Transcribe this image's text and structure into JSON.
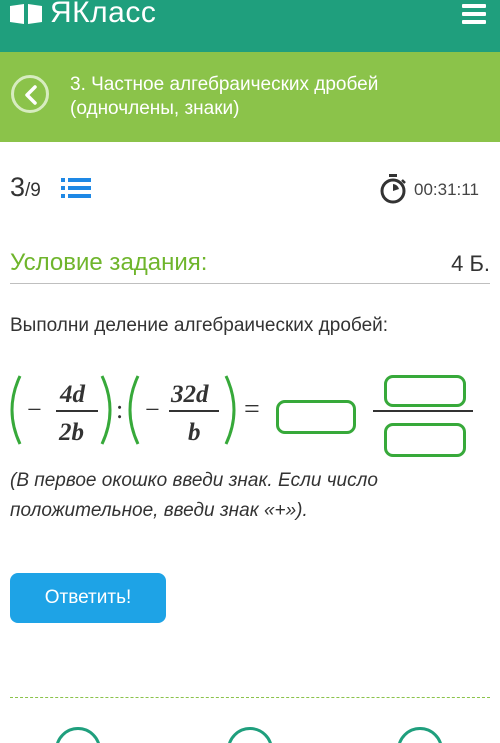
{
  "header": {
    "logo_text": "ЯКласс",
    "logo_icon": "book-icon",
    "menu_icon": "hamburger-icon"
  },
  "lesson": {
    "title": "3. Частное алгебраических дробей (одночлены, знаки)",
    "back_icon": "chevron-left-icon"
  },
  "progress": {
    "current": "3",
    "total": "/9",
    "list_icon": "list-icon"
  },
  "timer": {
    "icon": "stopwatch-icon",
    "value": "00:31:11"
  },
  "condition": {
    "title": "Условие задания:",
    "points": "4 Б."
  },
  "task": {
    "text": "Выполни деление алгебраических дробей:",
    "hint": "(В первое окошко введи знак. Если число положительное, введи знак «+»)."
  },
  "formula": {
    "frac1_num": "4d",
    "frac1_den": "2b",
    "frac2_num": "32d",
    "frac2_den": "b",
    "minus": "−",
    "div": ":",
    "eq": "="
  },
  "answer_button": "Ответить!",
  "colors": {
    "header": "#1f9f7d",
    "lesson_bar": "#8bc34a",
    "accent_green": "#6fb52c",
    "button": "#1ea3e6",
    "input_border": "#37a93a"
  }
}
